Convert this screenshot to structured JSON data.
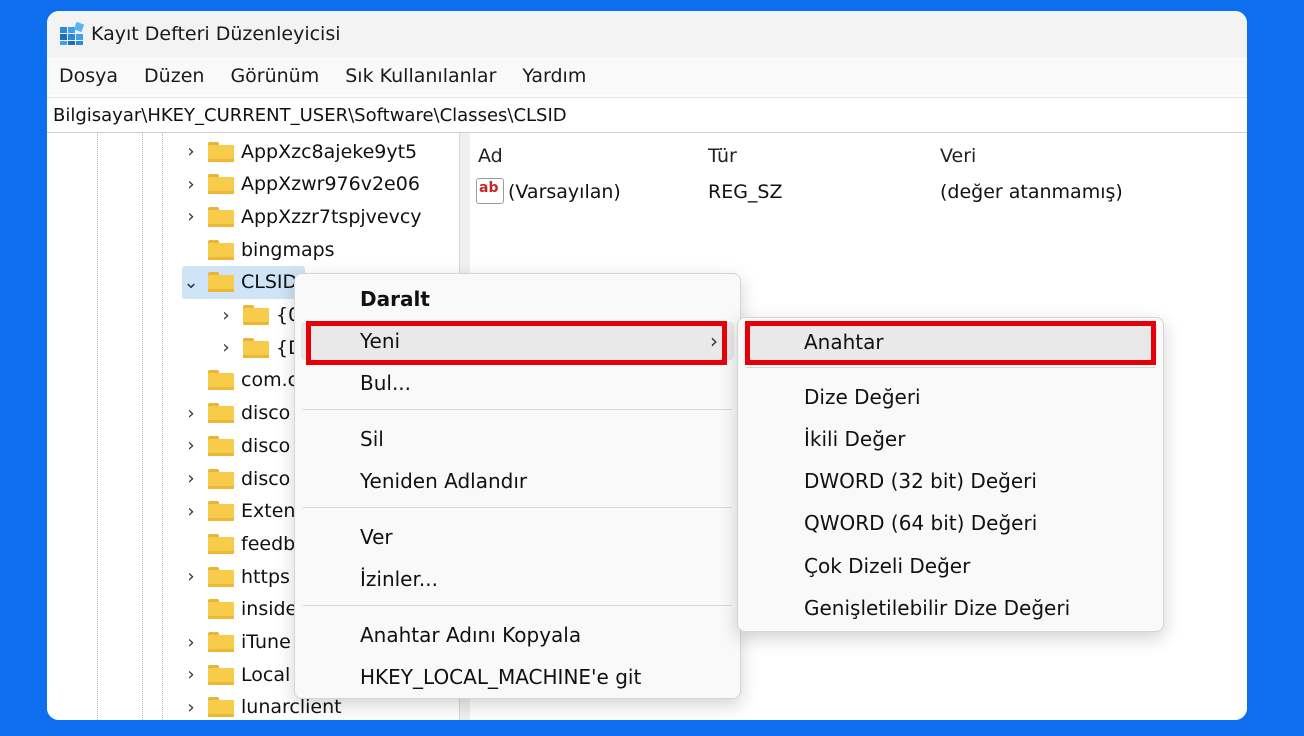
{
  "window": {
    "title": "Kayıt Defteri Düzenleyicisi"
  },
  "menu": [
    "Dosya",
    "Düzen",
    "Görünüm",
    "Sık Kullanılanlar",
    "Yardım"
  ],
  "address": "Bilgisayar\\HKEY_CURRENT_USER\\Software\\Classes\\CLSID",
  "tree": [
    {
      "label": "AppXzc8ajeke9yt5",
      "expander": "›"
    },
    {
      "label": "AppXzwr976v2e06",
      "expander": "›"
    },
    {
      "label": "AppXzzr7tspjvevcy",
      "expander": "›"
    },
    {
      "label": "bingmaps",
      "expander": ""
    },
    {
      "label": "CLSID",
      "expander": "⌄"
    },
    {
      "label": "{0(",
      "expander": "›"
    },
    {
      "label": "{D",
      "expander": "›"
    },
    {
      "label": "com.c",
      "expander": ""
    },
    {
      "label": "disco",
      "expander": "›"
    },
    {
      "label": "disco",
      "expander": "›"
    },
    {
      "label": "disco",
      "expander": "›"
    },
    {
      "label": "Exten",
      "expander": "›"
    },
    {
      "label": "feedb",
      "expander": ""
    },
    {
      "label": "https",
      "expander": "›"
    },
    {
      "label": "inside",
      "expander": ""
    },
    {
      "label": "iTune",
      "expander": "›"
    },
    {
      "label": "Local",
      "expander": "›"
    },
    {
      "label": "lunarclient",
      "expander": "›"
    }
  ],
  "list": {
    "headers": {
      "name": "Ad",
      "type": "Tür",
      "data": "Veri"
    },
    "row": {
      "icon_text": "ab",
      "name": "(Varsayılan)",
      "type": "REG_SZ",
      "data": "(değer atanmamış)"
    }
  },
  "context_menu": {
    "items": [
      "Daralt",
      "Yeni",
      "Bul...",
      "Sil",
      "Yeniden Adlandır",
      "Ver",
      "İzinler...",
      "Anahtar Adını Kopyala",
      "HKEY_LOCAL_MACHINE'e git"
    ],
    "submenu_arrow": "›"
  },
  "submenu": {
    "items": [
      "Anahtar",
      "Dize Değeri",
      "İkili Değer",
      "DWORD (32 bit) Değeri",
      "QWORD (64 bit) Değeri",
      "Çok Dizeli Değer",
      "Genişletilebilir Dize Değeri"
    ]
  },
  "colors": {
    "background": "#0d6ef0",
    "highlight_box": "#e5000a",
    "folder": "#f7cc4a"
  },
  "icons": {
    "app": "registry-editor-icon",
    "folder": "folder-icon",
    "value": "string-value-icon"
  }
}
